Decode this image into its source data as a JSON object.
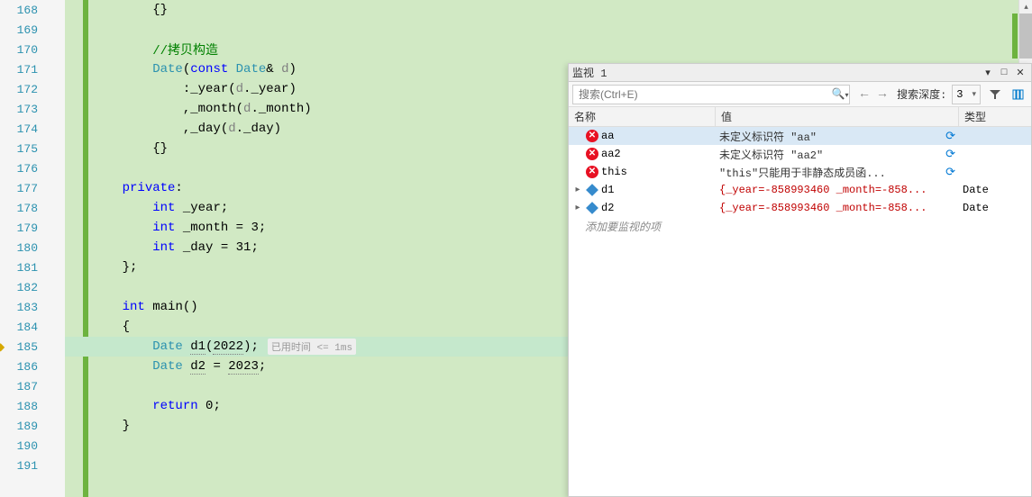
{
  "editor": {
    "lines": [
      {
        "num": 168,
        "content": "        {}"
      },
      {
        "num": 169,
        "content": ""
      },
      {
        "num": 170,
        "fold": "none",
        "comment": "        //拷贝构造"
      },
      {
        "num": 171,
        "fold": "minus",
        "tokens": [
          {
            "t": "        "
          },
          {
            "t": "Date",
            "c": "type"
          },
          {
            "t": "("
          },
          {
            "t": "const",
            "c": "kw"
          },
          {
            "t": " "
          },
          {
            "t": "Date",
            "c": "type"
          },
          {
            "t": "& "
          },
          {
            "t": "d",
            "c": "param"
          },
          {
            "t": ")"
          }
        ]
      },
      {
        "num": 172,
        "indent_line": true,
        "tokens": [
          {
            "t": "            :"
          },
          {
            "t": "_year",
            "c": "ident"
          },
          {
            "t": "("
          },
          {
            "t": "d",
            "c": "param"
          },
          {
            "t": "."
          },
          {
            "t": "_year",
            "c": "ident"
          },
          {
            "t": ")"
          }
        ]
      },
      {
        "num": 173,
        "indent_line": true,
        "tokens": [
          {
            "t": "            ,"
          },
          {
            "t": "_month",
            "c": "ident"
          },
          {
            "t": "("
          },
          {
            "t": "d",
            "c": "param"
          },
          {
            "t": "."
          },
          {
            "t": "_month",
            "c": "ident"
          },
          {
            "t": ")"
          }
        ]
      },
      {
        "num": 174,
        "indent_line": true,
        "tokens": [
          {
            "t": "            ,"
          },
          {
            "t": "_day",
            "c": "ident"
          },
          {
            "t": "("
          },
          {
            "t": "d",
            "c": "param"
          },
          {
            "t": "."
          },
          {
            "t": "_day",
            "c": "ident"
          },
          {
            "t": ")"
          }
        ]
      },
      {
        "num": 175,
        "content": "        {}"
      },
      {
        "num": 176,
        "content": ""
      },
      {
        "num": 177,
        "tokens": [
          {
            "t": "    "
          },
          {
            "t": "private",
            "c": "kw"
          },
          {
            "t": ":"
          }
        ]
      },
      {
        "num": 178,
        "tokens": [
          {
            "t": "        "
          },
          {
            "t": "int",
            "c": "kw"
          },
          {
            "t": " _year;"
          }
        ]
      },
      {
        "num": 179,
        "tokens": [
          {
            "t": "        "
          },
          {
            "t": "int",
            "c": "kw"
          },
          {
            "t": " _month = 3;"
          }
        ]
      },
      {
        "num": 180,
        "tokens": [
          {
            "t": "        "
          },
          {
            "t": "int",
            "c": "kw"
          },
          {
            "t": " _day = 31;"
          }
        ]
      },
      {
        "num": 181,
        "content": "    };"
      },
      {
        "num": 182,
        "content": ""
      },
      {
        "num": 183,
        "fold": "minus",
        "tokens": [
          {
            "t": "    "
          },
          {
            "t": "int",
            "c": "kw"
          },
          {
            "t": " "
          },
          {
            "t": "main",
            "c": "ident"
          },
          {
            "t": "()"
          }
        ]
      },
      {
        "num": 184,
        "content": "    {"
      },
      {
        "num": 185,
        "highlight": true,
        "current": true,
        "tokens": [
          {
            "t": "        "
          },
          {
            "t": "Date",
            "c": "type"
          },
          {
            "t": " "
          },
          {
            "t": "d1",
            "c": "ident",
            "dotted": true
          },
          {
            "t": "("
          },
          {
            "t": "2022",
            "dotted": true
          },
          {
            "t": ");"
          }
        ],
        "hint": "已用时间 <= 1ms"
      },
      {
        "num": 186,
        "tokens": [
          {
            "t": "        "
          },
          {
            "t": "Date",
            "c": "type"
          },
          {
            "t": " "
          },
          {
            "t": "d2",
            "c": "ident",
            "dotted": true
          },
          {
            "t": " = "
          },
          {
            "t": "2023",
            "dotted": true
          },
          {
            "t": ";"
          }
        ]
      },
      {
        "num": 187,
        "content": ""
      },
      {
        "num": 188,
        "tokens": [
          {
            "t": "        "
          },
          {
            "t": "return",
            "c": "kw"
          },
          {
            "t": " 0;"
          }
        ]
      },
      {
        "num": 189,
        "content": "    }"
      },
      {
        "num": 190,
        "content": ""
      },
      {
        "num": 191,
        "content": ""
      }
    ]
  },
  "watch": {
    "title": "监视 1",
    "search_placeholder": "搜索(Ctrl+E)",
    "depth_label": "搜索深度:",
    "depth_value": "3",
    "headers": {
      "name": "名称",
      "value": "值",
      "type": "类型"
    },
    "rows": [
      {
        "kind": "error",
        "name": "aa",
        "value": "未定义标识符 \"aa\"",
        "type": "",
        "selected": true,
        "refresh": true
      },
      {
        "kind": "error",
        "name": "aa2",
        "value": "未定义标识符 \"aa2\"",
        "type": "",
        "refresh": true
      },
      {
        "kind": "error",
        "name": "this",
        "value": "\"this\"只能用于非静态成员函...",
        "type": "",
        "refresh": true
      },
      {
        "kind": "obj",
        "expand": true,
        "name": "d1",
        "value": "{_year=-858993460 _month=-858...",
        "value_red": true,
        "type": "Date"
      },
      {
        "kind": "obj",
        "expand": true,
        "name": "d2",
        "value": "{_year=-858993460 _month=-858...",
        "value_red": true,
        "type": "Date"
      }
    ],
    "add_row": "添加要监视的项"
  }
}
